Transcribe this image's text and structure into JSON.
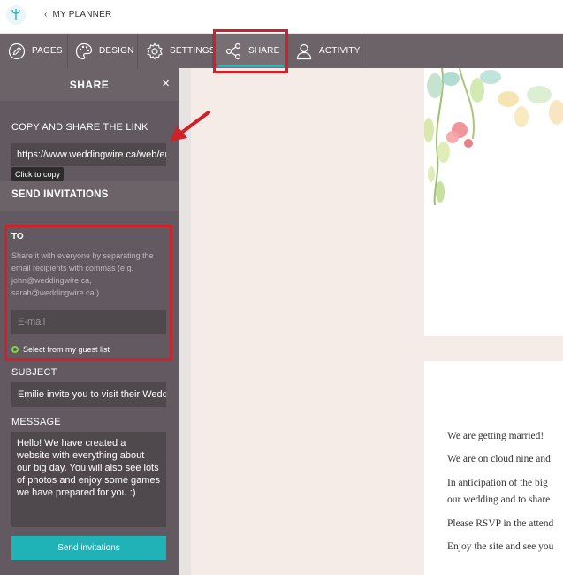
{
  "topbar": {
    "back_label": "MY PLANNER"
  },
  "nav": [
    {
      "label": "PAGES",
      "icon": "pencil-icon"
    },
    {
      "label": "DESIGN",
      "icon": "palette-icon"
    },
    {
      "label": "SETTINGS",
      "icon": "gear-icon"
    },
    {
      "label": "SHARE",
      "icon": "share-icon",
      "active": true
    },
    {
      "label": "ACTIVITY",
      "icon": "user-icon"
    }
  ],
  "sidebar": {
    "title": "SHARE",
    "close_glyph": "×",
    "copy_title": "COPY AND SHARE THE LINK",
    "link_value": "https://www.weddingwire.ca/web/emilie-and-",
    "tooltip": "Click to copy",
    "invite_title": "SEND INVITATIONS",
    "to_label": "TO",
    "to_hint": "Share it with everyone by separating the email recipients with commas (e.g. john@weddingwire.ca, sarah@weddingwire.ca )",
    "email_placeholder": "E-mail",
    "guest_link": "Select from my guest list",
    "subject_label": "SUBJECT",
    "subject_value": "Emilie invite you to visit their Wedding website",
    "message_label": "MESSAGE",
    "message_value": "Hello! We have created a website with everything about our big day. You will also see lots of photos and enjoy some games we have prepared for you :)",
    "send_label": "Send invitations"
  },
  "preview": {
    "lines": [
      "We are getting married!",
      "We are on cloud nine and",
      "In anticipation of the big",
      "our wedding and to share",
      "Please RSVP in the attend",
      "Enjoy the site and see you"
    ]
  },
  "colors": {
    "accent": "#1fb3b8",
    "highlight": "#d0202a",
    "sidebar": "#625a60",
    "nav": "#6c6369"
  }
}
